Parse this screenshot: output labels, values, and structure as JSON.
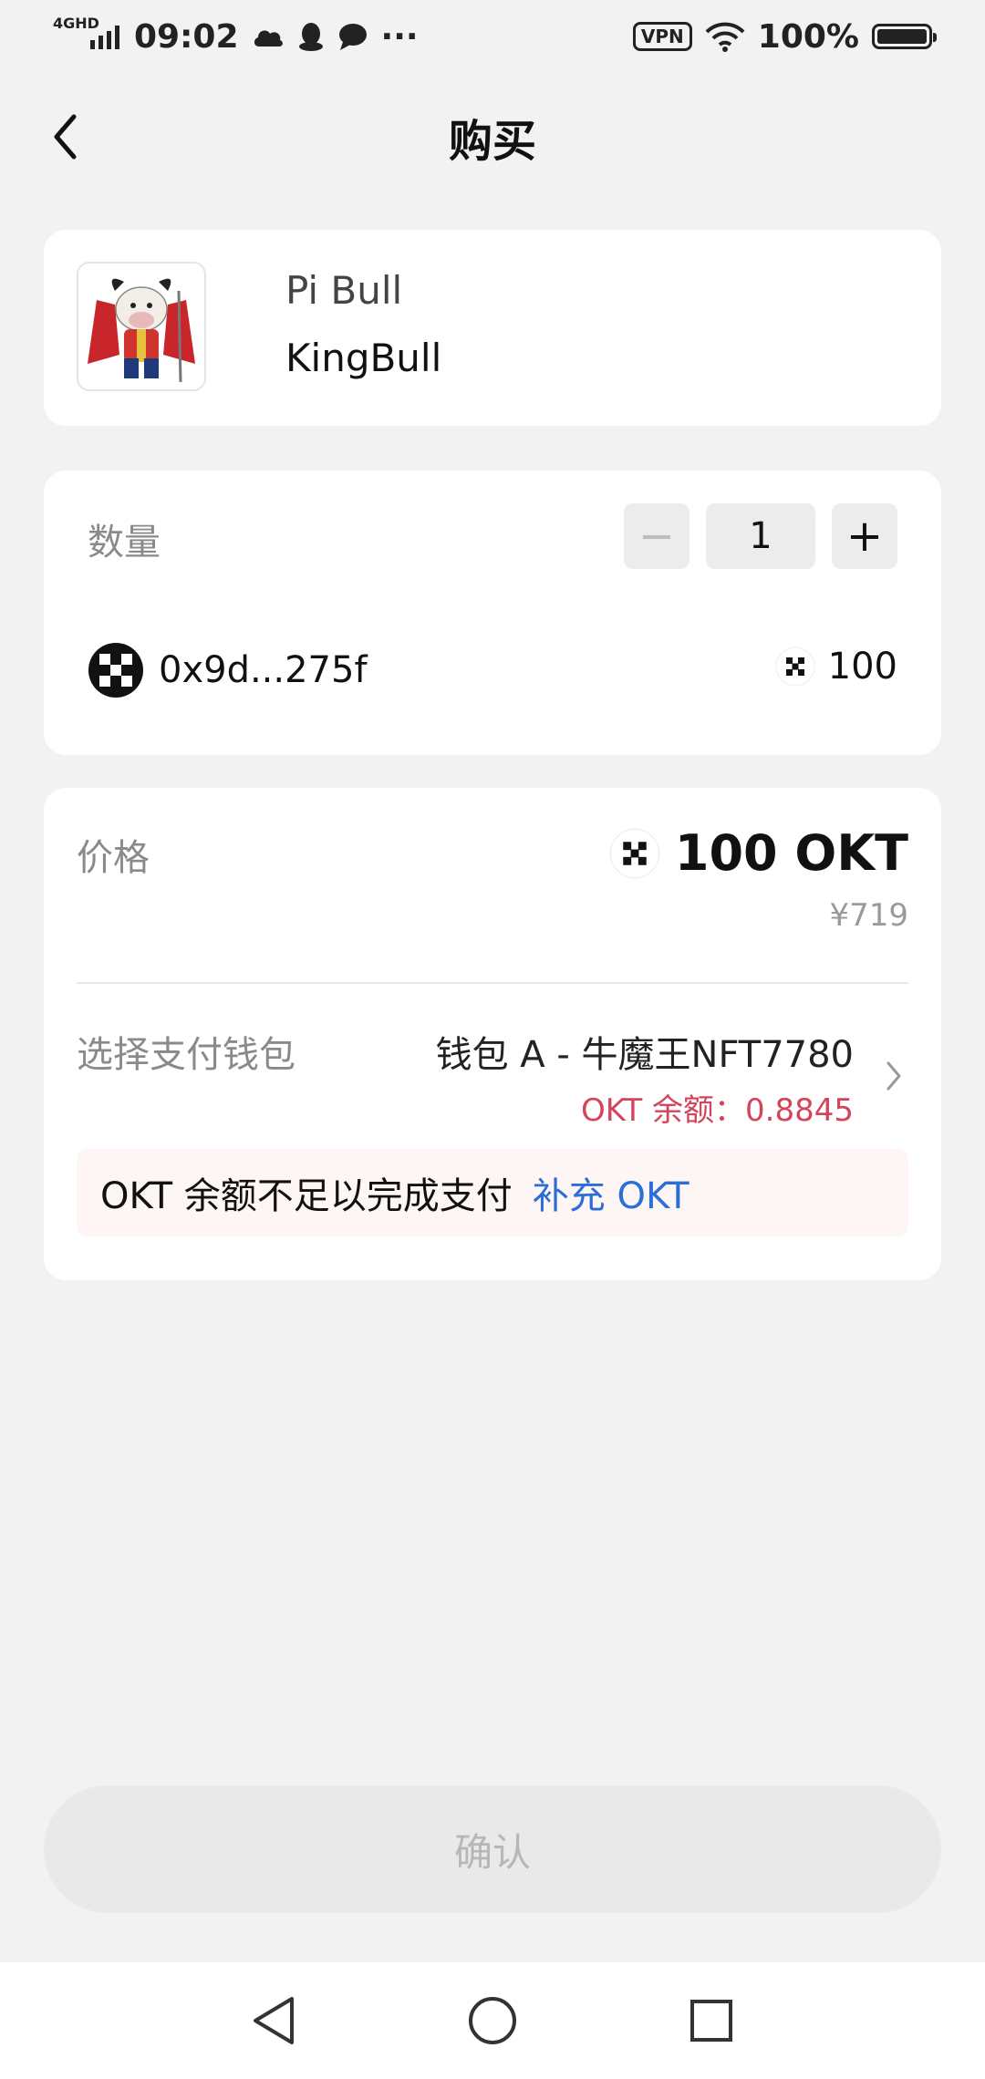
{
  "status_bar": {
    "network": "4GHD",
    "time": "09:02",
    "vpn": "VPN",
    "battery": "100%",
    "more": "···"
  },
  "header": {
    "title": "购买"
  },
  "nft": {
    "collection": "Pi Bull",
    "name": "KingBull"
  },
  "quantity": {
    "label": "数量",
    "minus": "−",
    "value": "1",
    "plus": "+"
  },
  "owner": {
    "address": "0x9d...275f",
    "balance": "100"
  },
  "price": {
    "label": "价格",
    "amount": "100 OKT",
    "fiat": "¥719"
  },
  "wallet": {
    "label": "选择支付钱包",
    "name": "钱包 A - 牛魔王NFT7780",
    "balance": "OKT 余额：0.8845"
  },
  "warning": {
    "text": "OKT 余额不足以完成支付",
    "link": "补充 OKT"
  },
  "actions": {
    "confirm": "确认"
  },
  "colors": {
    "background": "#f2f2f2",
    "card": "#ffffff",
    "link": "#2a6fd6",
    "danger": "#d2455a",
    "warn_bg": "#fdf6f4"
  }
}
